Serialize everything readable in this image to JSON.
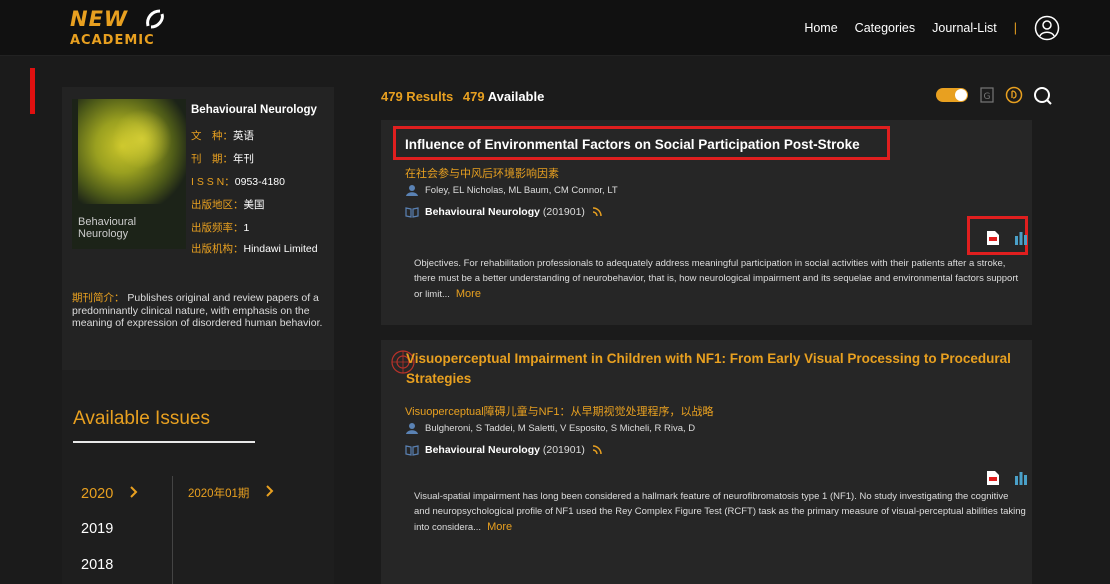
{
  "logo": {
    "top": "NEW",
    "bottom": "ACADEMIC"
  },
  "nav": {
    "items": [
      "Home",
      "Categories",
      "Journal-List"
    ],
    "separator": "|"
  },
  "journal": {
    "cover_title": "Behavioural Neurology",
    "title": "Behavioural Neurology",
    "fields": [
      {
        "key": "文　种：",
        "value": "英语"
      },
      {
        "key": "刊　期：",
        "value": "年刊"
      },
      {
        "key": "I S S N：",
        "value": "0953-4180"
      },
      {
        "key": "出版地区：",
        "value": "美国"
      },
      {
        "key": "出版频率：",
        "value": "1"
      },
      {
        "key": "出版机构：",
        "value": "Hindawi Limited"
      }
    ],
    "desc_label": "期刊简介：",
    "desc": "Publishes original and review papers of a predominantly clinical nature, with emphasis on the meaning of expression of disordered human behavior."
  },
  "issues": {
    "heading": "Available Issues",
    "years": [
      "2020",
      "2019",
      "2018"
    ],
    "selected_issue": "2020年01期"
  },
  "results": {
    "count": "479 Results",
    "available_num": "479",
    "available_label": "Available"
  },
  "articles": [
    {
      "title": "Influence of Environmental Factors on Social Participation Post-Stroke",
      "title_cn": "在社会参与中风后环境影响因素",
      "authors": "Foley, EL  Nicholas, ML  Baum, CM  Connor, LT",
      "journal": "Behavioural Neurology",
      "issue": "(201901)",
      "abstract": "Objectives. For rehabilitation professionals to adequately address meaningful participation in social activities with their patients after a stroke, there must be a better understanding of neurobehavior, that is, how neurological impairment and its sequelae and environmental factors support or limit...",
      "more": "More"
    },
    {
      "title": "Visuoperceptual Impairment in Children with NF1: From Early Visual Processing to Procedural Strategies",
      "title_cn": "Visuoperceptual障碍儿童与NF1：从早期视觉处理程序，以战略",
      "authors": "Bulgheroni, S  Taddei, M  Saletti, V  Esposito, S  Micheli, R  Riva, D",
      "journal": "Behavioural Neurology",
      "issue": "(201901)",
      "abstract": "Visual-spatial impairment has long been considered a hallmark feature of neurofibromatosis type 1 (NF1). No study investigating the cognitive and neuropsychological profile of NF1 used the Rey Complex Figure Test (RCFT) task as the primary measure of visual-perceptual abilities taking into considera...",
      "more": "More"
    }
  ],
  "colors": {
    "accent": "#e8a020",
    "highlight_box": "#e01f1f",
    "background": "#1b1b1b"
  }
}
